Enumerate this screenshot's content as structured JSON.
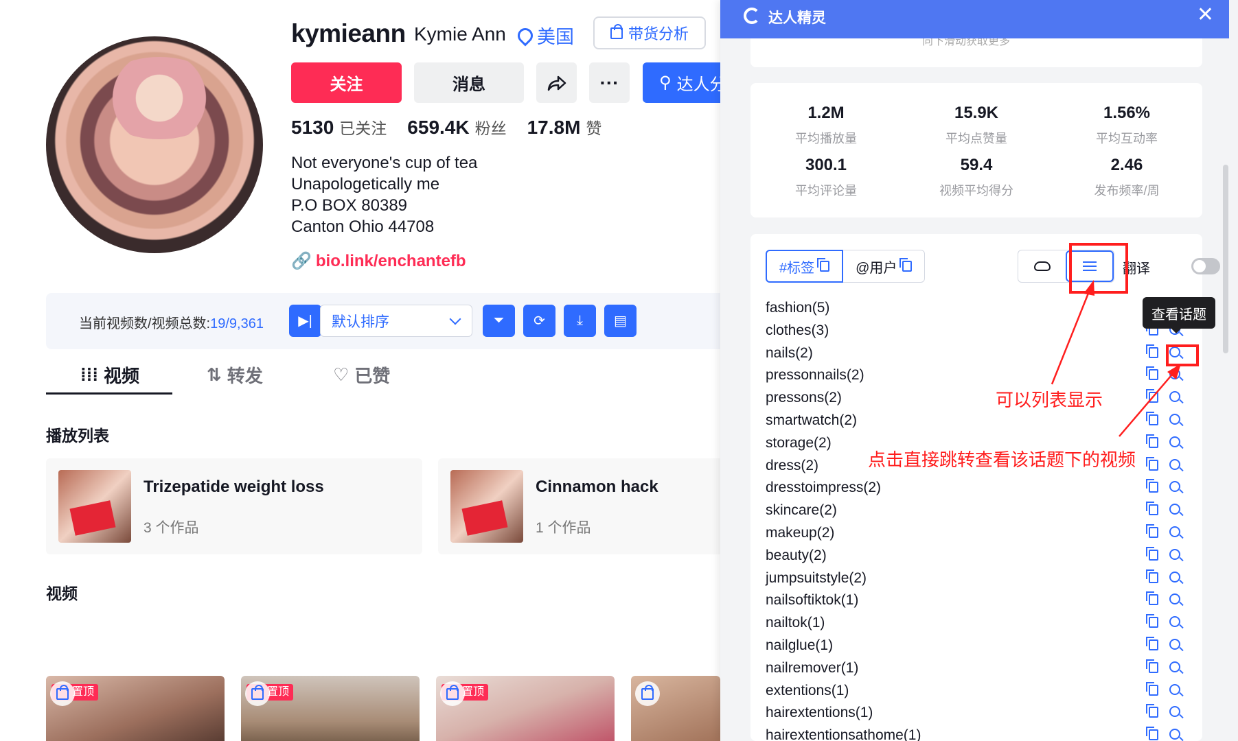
{
  "profile": {
    "username": "kymieann",
    "nickname": "Kymie Ann",
    "country": "美国",
    "goods_btn": "带货分析",
    "follow_btn": "关注",
    "message_btn": "消息",
    "expert_btn": "达人分",
    "stats": [
      {
        "value": "5130",
        "label": "已关注"
      },
      {
        "value": "659.4K",
        "label": "粉丝"
      },
      {
        "value": "17.8M",
        "label": "赞"
      }
    ],
    "bio": [
      "Not everyone's cup of tea",
      "Unapologetically me",
      "P.O BOX 80389",
      "Canton Ohio 44708"
    ],
    "link": "bio.link/enchantefb"
  },
  "toolbar": {
    "label": "当前视频数/视频总数:",
    "count": "19/9,361",
    "sort": "默认排序"
  },
  "tabs": [
    "视频",
    "转发",
    "已赞"
  ],
  "sections": {
    "playlist": "播放列表",
    "videos": "视频"
  },
  "playlists": [
    {
      "title": "Trizepatide weight loss",
      "count": "3 个作品"
    },
    {
      "title": "Cinnamon hack",
      "count": "1 个作品"
    }
  ],
  "pinned_label": "置顶",
  "panel": {
    "title": "达人精灵",
    "top_hint": "向下滑动获取更多",
    "metrics": [
      {
        "value": "1.2M",
        "label": "平均播放量"
      },
      {
        "value": "15.9K",
        "label": "平均点赞量"
      },
      {
        "value": "1.56%",
        "label": "平均互动率"
      },
      {
        "value": "300.1",
        "label": "平均评论量"
      },
      {
        "value": "59.4",
        "label": "视频平均得分"
      },
      {
        "value": "2.46",
        "label": "发布频率/周"
      }
    ],
    "seg_tags": "#标签",
    "seg_users": "@用户",
    "translate": "翻译",
    "tooltip": "查看话题",
    "tags": [
      "fashion(5)",
      "clothes(3)",
      "nails(2)",
      "pressonnails(2)",
      "pressons(2)",
      "smartwatch(2)",
      "storage(2)",
      "dress(2)",
      "dresstoimpress(2)",
      "skincare(2)",
      "makeup(2)",
      "beauty(2)",
      "jumpsuitstyle(2)",
      "nailsoftiktok(1)",
      "nailtok(1)",
      "nailglue(1)",
      "nailremover(1)",
      "extentions(1)",
      "hairextentions(1)",
      "hairextentionsathome(1)"
    ]
  },
  "annotations": {
    "list_view": "可以列表显示",
    "click_jump": "点击直接跳转查看该话题下的视频"
  },
  "colors": {
    "accent": "#2f6bff",
    "follow": "#fe2c55",
    "annotation": "#ff1e1e",
    "panel_header": "#4f77f2"
  }
}
